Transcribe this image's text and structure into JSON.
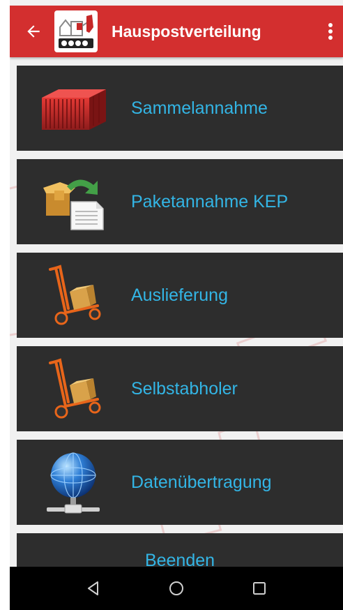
{
  "appbar": {
    "title": "Hauspostverteilung",
    "back_icon": "back-arrow-icon",
    "overflow_icon": "more-vert-icon",
    "logo_icon": "app-logo-icon",
    "color": "#d32f2f"
  },
  "menu": {
    "items": [
      {
        "label": "Sammelannahme",
        "icon": "container-icon"
      },
      {
        "label": "Paketannahme KEP",
        "icon": "parcel-document-icon"
      },
      {
        "label": "Auslieferung",
        "icon": "hand-truck-icon"
      },
      {
        "label": "Selbstabholer",
        "icon": "hand-truck-icon"
      },
      {
        "label": "Datenübertragung",
        "icon": "globe-network-icon"
      },
      {
        "label": "Beenden"
      }
    ],
    "label_color": "#33b5e5",
    "item_background": "#2d2d2d"
  },
  "navbar": {
    "back_icon": "nav-back-icon",
    "home_icon": "nav-home-icon",
    "recents_icon": "nav-recents-icon"
  }
}
